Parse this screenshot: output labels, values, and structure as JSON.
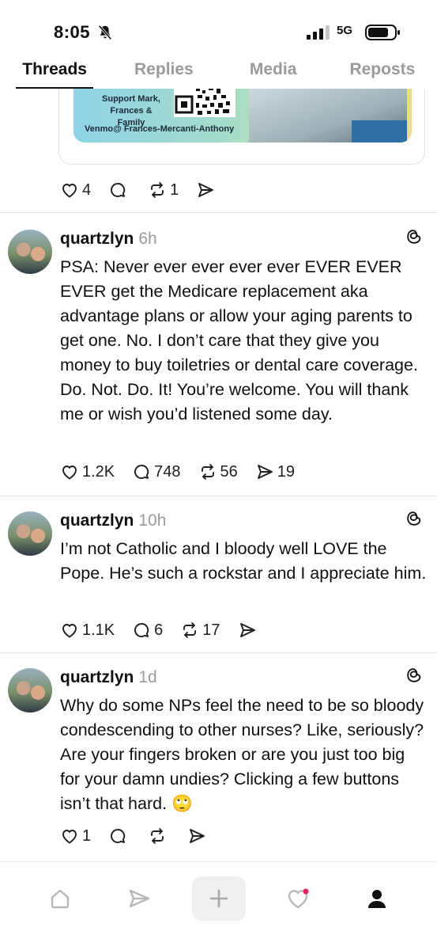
{
  "status_bar": {
    "time": "8:05",
    "network": "5G"
  },
  "tabs": [
    {
      "label": "Threads",
      "active": true
    },
    {
      "label": "Replies",
      "active": false
    },
    {
      "label": "Media",
      "active": false
    },
    {
      "label": "Reposts",
      "active": false
    }
  ],
  "previous_post": {
    "flyer_text": [
      "Support Mark,",
      "Frances & Family"
    ],
    "venmo": "Venmo@ Frances-Mercanti-Anthony",
    "likes": "4",
    "replies": "",
    "reposts": "1",
    "shares": ""
  },
  "posts": [
    {
      "username": "quartzlyn",
      "time_ago": "6h",
      "text": "PSA: Never ever ever ever ever EVER EVER EVER get the Medicare replacement aka advantage plans or allow your aging parents to get one. No. I don’t care that they give you money to buy toiletries or dental care coverage. Do. Not. Do. It! You’re welcome. You will thank me or wish you’d listened some day.",
      "likes": "1.2K",
      "replies": "748",
      "reposts": "56",
      "shares": "19"
    },
    {
      "username": "quartzlyn",
      "time_ago": "10h",
      "text": "I’m not Catholic and I bloody well LOVE the Pope. He’s such a rockstar and I appreciate him.",
      "likes": "1.1K",
      "replies": "6",
      "reposts": "17",
      "shares": ""
    },
    {
      "username": "quartzlyn",
      "time_ago": "1d",
      "text": "Why do some NPs feel the need to be so bloody condescending to other nurses? Like, seriously? Are your fingers broken or are you just too big for your damn undies? Clicking a few buttons isn’t that hard. 🙄",
      "likes": "1",
      "replies": "",
      "reposts": "",
      "shares": ""
    }
  ],
  "bottom_nav": [
    "home-icon",
    "send-icon",
    "plus-icon",
    "heart-icon",
    "profile-icon"
  ],
  "colors": {
    "text": "#101010",
    "muted": "#9a9a9a",
    "notification_dot": "#e0245e"
  }
}
